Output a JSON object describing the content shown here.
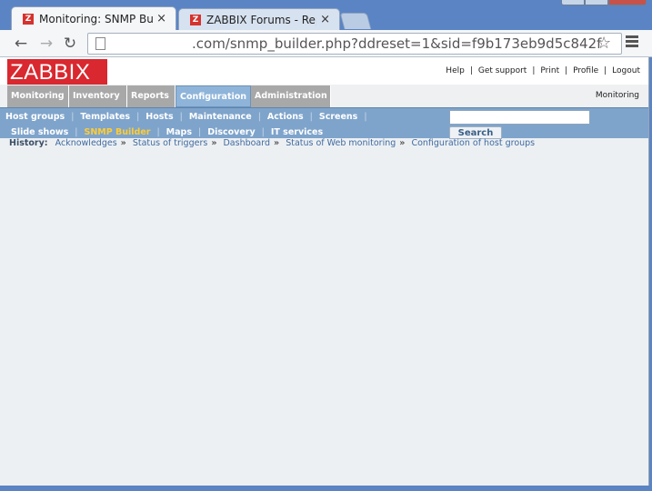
{
  "browser": {
    "tabs": [
      {
        "title": "Monitoring: SNMP Builde",
        "favicon": "Z",
        "active": true
      },
      {
        "title": "ZABBIX Forums - Reply to",
        "favicon": "Z",
        "active": false
      }
    ],
    "tab_close_glyph": "×",
    "url": ".com/snmp_builder.php?ddreset=1&sid=f9b173eb9d5c842f"
  },
  "header": {
    "logo": "ZABBIX",
    "links": [
      "Help",
      "Get support",
      "Print",
      "Profile",
      "Logout"
    ]
  },
  "main_menu": {
    "items": [
      "Monitoring",
      "Inventory",
      "Reports",
      "Configuration",
      "Administration"
    ],
    "selected": "Configuration",
    "right_text": "Monitoring"
  },
  "sub_menu": {
    "row1": [
      "Host groups",
      "Templates",
      "Hosts",
      "Maintenance",
      "Actions",
      "Screens"
    ],
    "row2": [
      "Slide shows",
      "SNMP Builder",
      "Maps",
      "Discovery",
      "IT services"
    ],
    "active": "SNMP Builder",
    "search_button": "Search"
  },
  "history": {
    "label": "History:",
    "items": [
      "Acknowledges",
      "Status of triggers",
      "Dashboard",
      "Status of Web monitoring",
      "Configuration of host groups"
    ],
    "separator": "»"
  },
  "colors": {
    "logo_bg": "#d9282f",
    "submenu_bg": "#7fa4cb",
    "active_submenu_text": "#ffcc33",
    "window_frame": "#5b84c4"
  }
}
